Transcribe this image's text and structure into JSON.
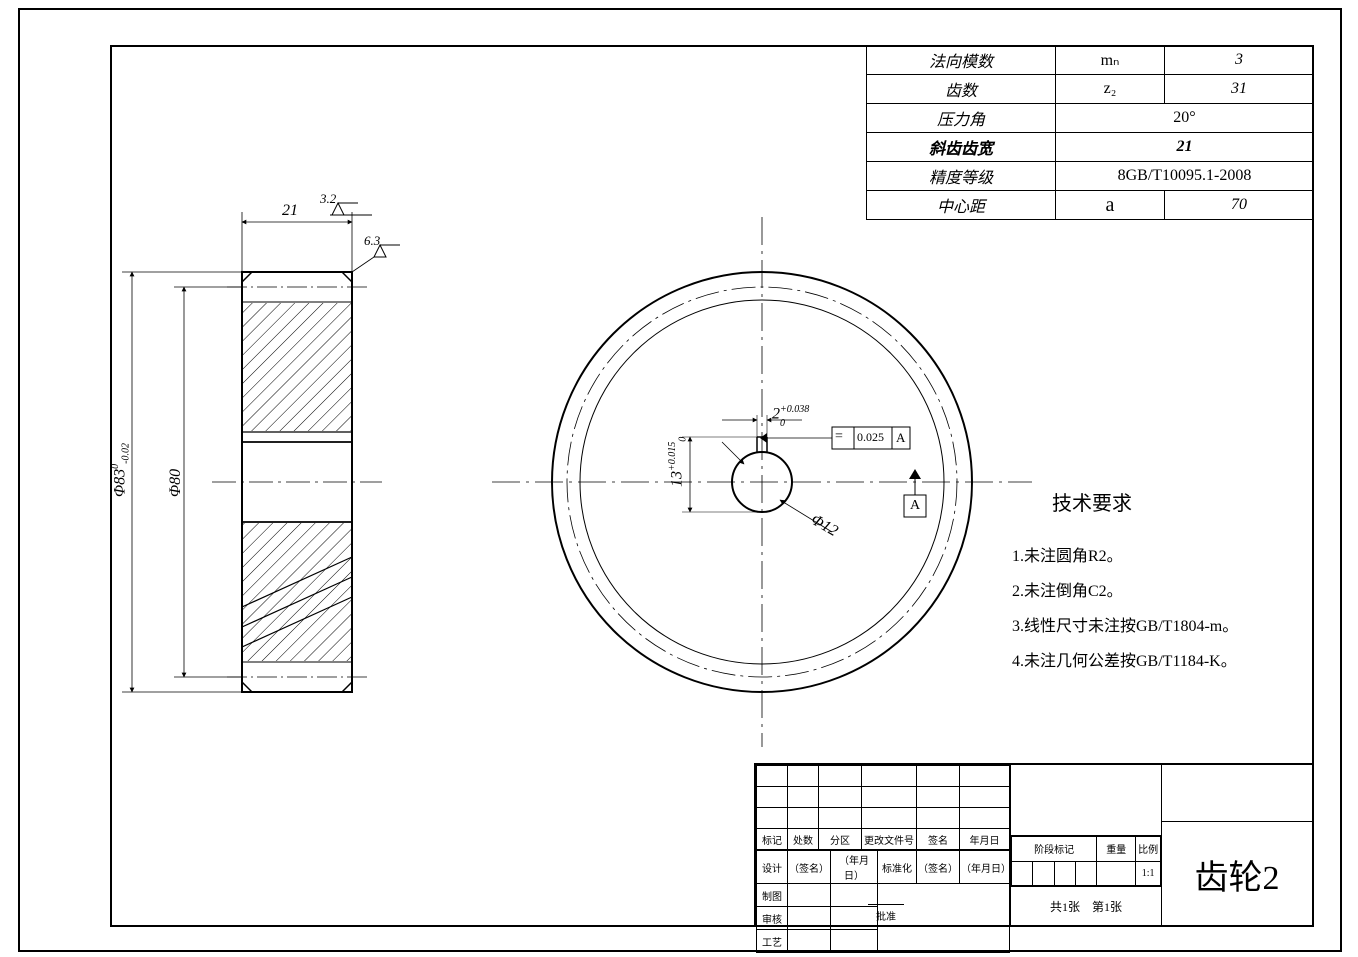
{
  "params": {
    "module_label": "法向模数",
    "module_sym": "mₙ",
    "module_val": "3",
    "teeth_label": "齿数",
    "teeth_sym": "z₂",
    "teeth_val": "31",
    "angle_label": "压力角",
    "angle_val": "20°",
    "helix_label": "斜齿齿宽",
    "helix_val": "21",
    "grade_label": "精度等级",
    "grade_val": "8GB/T10095.1-2008",
    "center_label": "中心距",
    "center_sym": "a",
    "center_val": "70"
  },
  "dims": {
    "width": "21",
    "sf1": "3.2",
    "sf2": "6.3",
    "d_outer": "Φ83",
    "d_outer_tol_up": "0",
    "d_outer_tol_lo": "-0.02",
    "d_pitch": "Φ80",
    "key_w": "2",
    "key_w_tol_up": "+0.038",
    "key_w_tol_lo": "0",
    "key_h": "13",
    "key_h_tol_up": "+0.015",
    "key_h_tol_lo": "0",
    "bore": "Φ12",
    "gtol_sym": "⇔",
    "gtol_val": "0.025",
    "gtol_datum": "A",
    "datum": "A"
  },
  "requirements": {
    "title": "技术要求",
    "r1": "1.未注圆角R2。",
    "r2": "2.未注倒角C2。",
    "r3": "3.线性尺寸未注按GB/T1804-m。",
    "r4": "4.未注几何公差按GB/T1184-K。"
  },
  "title_block": {
    "part_name": "齿轮2",
    "rev_cols": [
      "标记",
      "处数",
      "分区",
      "更改文件号",
      "签名",
      "年月日"
    ],
    "sign_rows": {
      "design": "设计",
      "sig": "（签名）",
      "date": "（年月日）",
      "std": "标准化",
      "draw": "制图",
      "check": "审核",
      "proc": "工艺",
      "approve": "批准",
      "stage": "阶段标记",
      "mass": "重量",
      "scale": "比例",
      "scale_val": "1:1",
      "sheet": "共1张　第1张"
    }
  }
}
